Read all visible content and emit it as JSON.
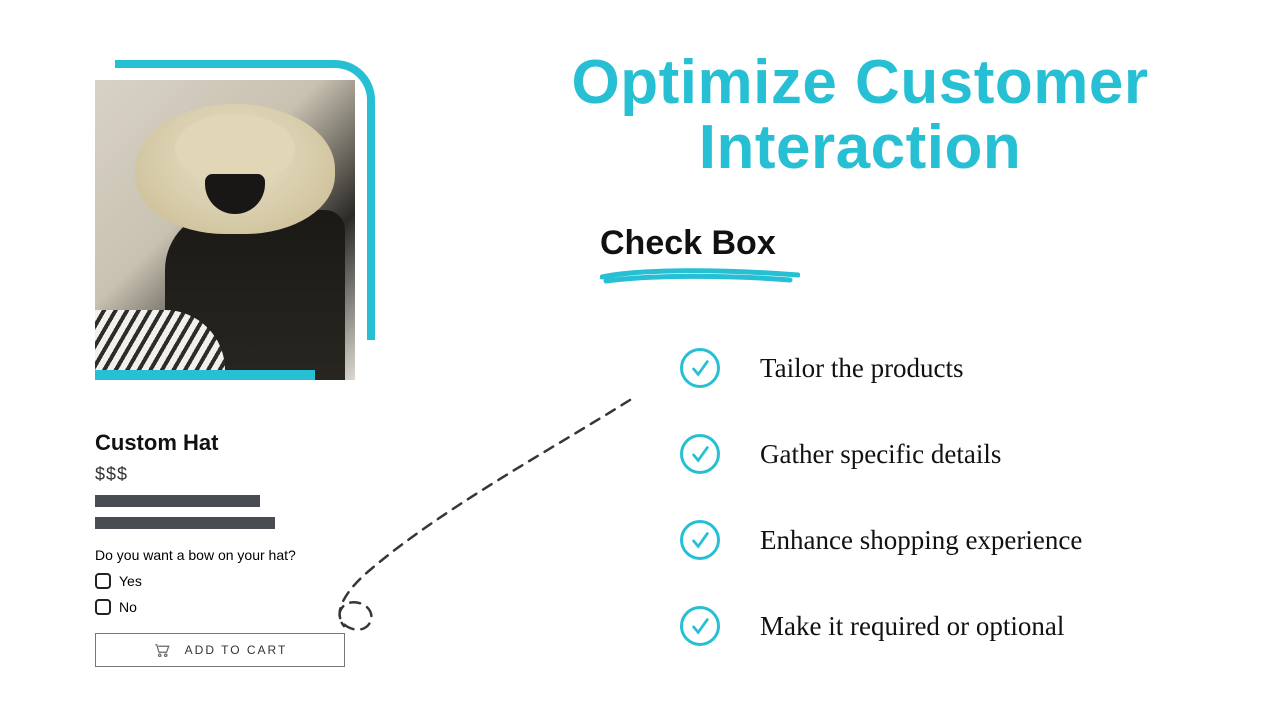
{
  "product": {
    "title": "Custom Hat",
    "price": "$$$",
    "question": "Do you want a bow on your hat?",
    "options": [
      "Yes",
      "No"
    ],
    "cart_label": "ADD TO CART"
  },
  "headline": "Optimize Customer Interaction",
  "subtitle": "Check Box",
  "features": [
    "Tailor the products",
    "Gather specific details",
    "Enhance shopping experience",
    "Make it required or optional"
  ],
  "colors": {
    "accent": "#27bfd4"
  }
}
